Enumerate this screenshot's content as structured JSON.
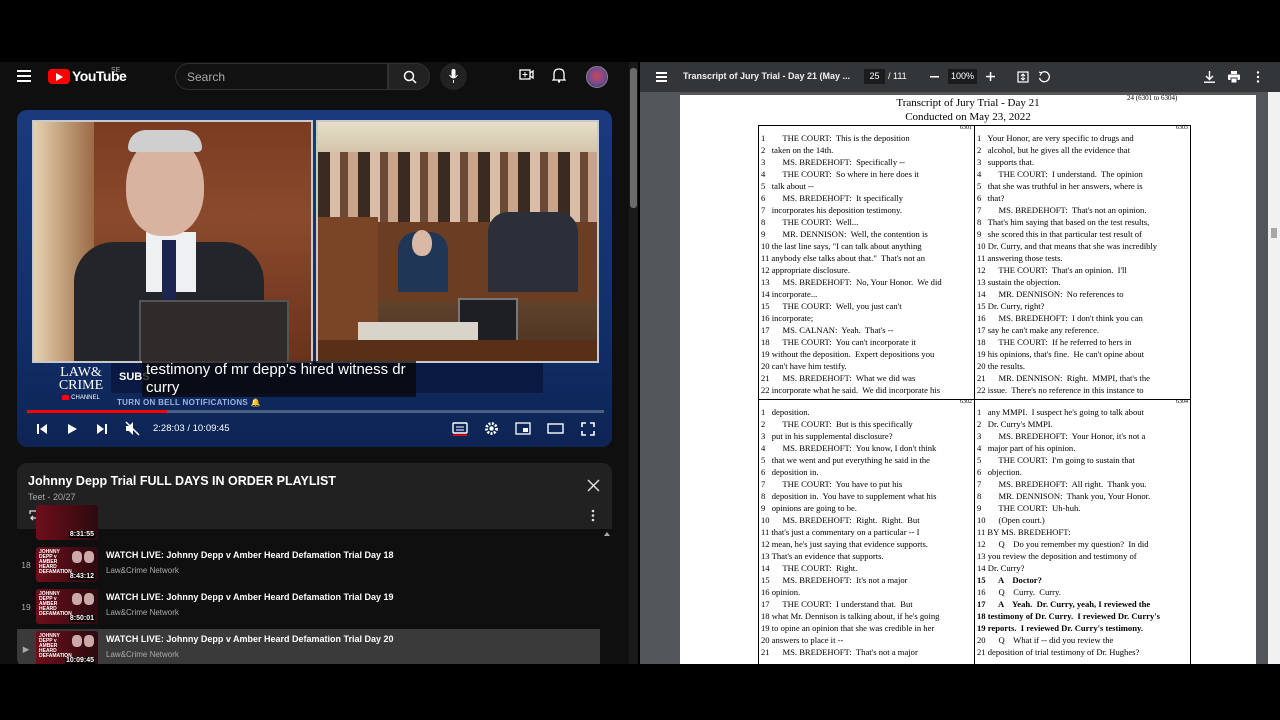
{
  "youtube": {
    "brand": "YouTube",
    "country_code": "SE",
    "search_placeholder": "Search",
    "video": {
      "caption_line1": "testimony of mr depp's hired witness dr",
      "caption_line2": "curry",
      "overlay_brand_line1": "LAW&",
      "overlay_brand_line2": "CRIME",
      "overlay_channel": "CHANNEL",
      "overlay_subscribe": "SUBS",
      "overlay_notify": "TURN ON BELL NOTIFICATIONS",
      "time_display": "2:28:03 / 10:09:45",
      "progress_fraction": 0.243
    },
    "playlist": {
      "title": "Johnny Depp Trial FULL DAYS IN ORDER PLAYLIST",
      "subtitle": "Teet - 20/27",
      "partial_duration": "8:31:55",
      "items": [
        {
          "num": "18",
          "title": "WATCH LIVE: Johnny Depp v Amber Heard Defamation Trial Day 18",
          "channel": "Law&Crime Network",
          "duration": "8:43:12",
          "thumb_text": "JOHNNY DEPP v AMBER HEARD DEFAMATION"
        },
        {
          "num": "19",
          "title": "WATCH LIVE: Johnny Depp v Amber Heard Defamation Trial Day 19",
          "channel": "Law&Crime Network",
          "duration": "8:50:01",
          "thumb_text": "JOHNNY DEPP v AMBER HEARD DEFAMATION"
        },
        {
          "num": "▶",
          "title": "WATCH LIVE: Johnny Depp v Amber Heard Defamation Trial Day 20",
          "channel": "Law&Crime Network",
          "duration": "10:09:45",
          "thumb_text": "JOHNNY DEPP v AMBER HEARD DEFAMATION"
        }
      ]
    }
  },
  "pdf": {
    "title": "Transcript of Jury Trial - Day 21 (May ...",
    "page": "25",
    "total": "/ 111",
    "zoom": "100%",
    "doc_title": "Transcript of Jury Trial - Day 21",
    "doc_subtitle": "Conducted on May 23, 2022",
    "page_ref": "24 (6301 to 6304)",
    "q6301": {
      "page": "6301",
      "lines": [
        "1        THE COURT:  This is the deposition",
        "2   taken on the 14th.",
        "3        MS. BREDEHOFT:  Specifically --",
        "4        THE COURT:  So where in here does it",
        "5   talk about --",
        "6        MS. BREDEHOFT:  It specifically",
        "7   incorporates his deposition testimony.",
        "8        THE COURT:  Well...",
        "9        MR. DENNISON:  Well, the contention is",
        "10 the last line says, \"I can talk about anything",
        "11 anybody else talks about that.\"  That's not an",
        "12 appropriate disclosure.",
        "13      MS. BREDEHOFT:  No, Your Honor.  We did",
        "14 incorporate...",
        "15      THE COURT:  Well, you just can't",
        "16 incorporate;",
        "17      MS. CALNAN:  Yeah.  That's --",
        "18      THE COURT:  You can't incorporate it",
        "19 without the deposition.  Expert depositions you",
        "20 can't have him testify.",
        "21      MS. BREDEHOFT:  What we did was",
        "22 incorporate what he said.  We did incorporate his"
      ]
    },
    "q6303": {
      "page": "6303",
      "lines": [
        "1   Your Honor, are very specific to drugs and",
        "2   alcohol, but he gives all the evidence that",
        "3   supports that.",
        "4        THE COURT:  I understand.  The opinion",
        "5   that she was truthful in her answers, where is",
        "6   that?",
        "7        MS. BREDEHOFT:  That's not an opinion.",
        "8   That's him saying that based on the test results,",
        "9   she scored this in that particular test result of",
        "10 Dr. Curry, and that means that she was incredibly",
        "11 answering those tests.",
        "12      THE COURT:  That's an opinion.  I'll",
        "13 sustain the objection.",
        "14      MR. DENNISON:  No references to",
        "15 Dr. Curry, right?",
        "16      MS. BREDEHOFT:  I don't think you can",
        "17 say he can't make any reference.",
        "18      THE COURT:  If he referred to hers in",
        "19 his opinions, that's fine.  He can't opine about",
        "20 the results.",
        "21      MR. DENNISON:  Right.  MMPI, that's the",
        "22 issue.  There's no reference in this instance to"
      ]
    },
    "q6302": {
      "page": "6302",
      "lines": [
        "1   deposition.",
        "2        THE COURT:  But is this specifically",
        "3   put in his supplemental disclosure?",
        "4        MS. BREDEHOFT:  You know, I don't think",
        "5   that we went and put everything he said in the",
        "6   deposition in.",
        "7        THE COURT:  You have to put his",
        "8   deposition in.  You have to supplement what his",
        "9   opinions are going to be.",
        "10      MS. BREDEHOFT:  Right.  Right.  But",
        "11 that's just a commentary on a particular -- I",
        "12 mean, he's just saying that evidence supports.",
        "13 That's an evidence that supports.",
        "14      THE COURT:  Right.",
        "15      MS. BREDEHOFT:  It's not a major",
        "16 opinion.",
        "17      THE COURT:  I understand that.  But",
        "18 what Mr. Dennison is talking about, if he's going",
        "19 to opine an opinion that she was credible in her",
        "20 answers to place it --",
        "21      MS. BREDEHOFT:  That's not a major"
      ]
    },
    "q6304": {
      "page": "6304",
      "lines": [
        "1   any MMPI.  I suspect he's going to talk about",
        "2   Dr. Curry's MMPI.",
        "3        MS. BREDEHOFT:  Your Honor, it's not a",
        "4   major part of his opinion.",
        "5        THE COURT:  I'm going to sustain that",
        "6   objection.",
        "7        MS. BREDEHOFT:  All right.  Thank you.",
        "8        MR. DENNISON:  Thank you, Your Honor.",
        "9        THE COURT:  Uh-huh.",
        "10      (Open court.)",
        "11 BY MS. BREDEHOFT:",
        "12      Q    Do you remember my question?  In did",
        "13 you review the deposition and testimony of",
        "14 Dr. Curry?",
        "15      A    Doctor?",
        "16      Q    Curry.  Curry.",
        "17      A    Yeah.  Dr. Curry, yeah, I reviewed the",
        "18 testimony of Dr. Curry.  I reviewed Dr. Curry's",
        "19 reports.  I reviewed Dr. Curry's testimony.",
        "20      Q    What if -- did you review the",
        "21 deposition of trial testimony of Dr. Hughes?"
      ],
      "bold_lines": [
        14,
        16,
        17,
        18
      ]
    }
  }
}
